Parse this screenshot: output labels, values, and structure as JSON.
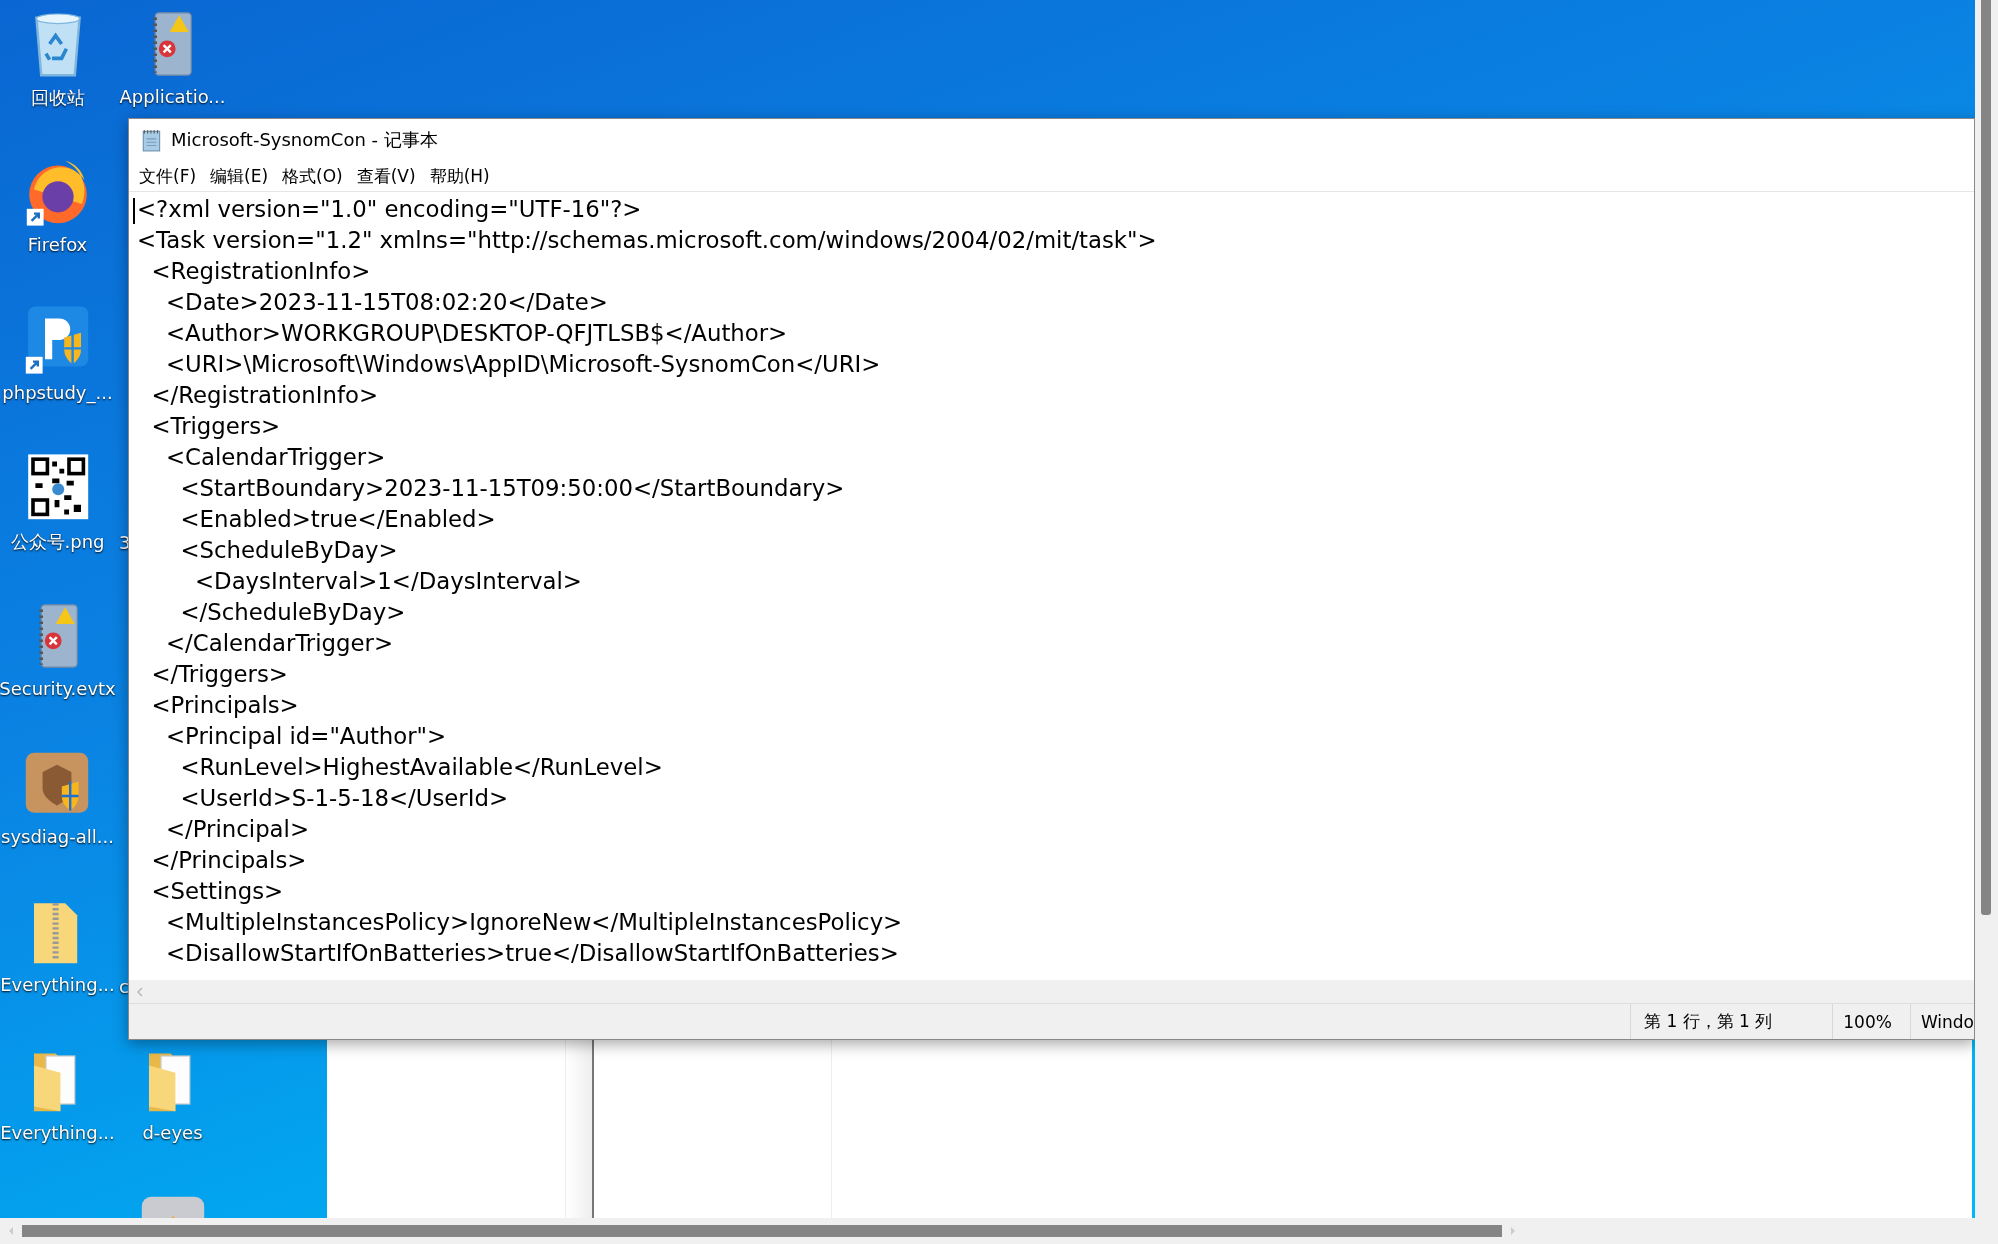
{
  "desktop": {
    "icons": [
      {
        "kind": "recycle-bin",
        "label": "回收站"
      },
      {
        "kind": "event-log",
        "label": "Applicatio..."
      },
      {
        "kind": "firefox",
        "label": "Firefox"
      },
      {
        "kind": "phpstudy",
        "label": "phpstudy_..."
      },
      {
        "kind": "qr-image",
        "label": "公众号.png"
      },
      {
        "kind": "hidden",
        "label": "3"
      },
      {
        "kind": "event-log",
        "label": "Security.evtx"
      },
      {
        "kind": "package",
        "label": "sysdiag-all..."
      },
      {
        "kind": "zip-folder",
        "label": "Everything..."
      },
      {
        "kind": "hidden",
        "label": "c"
      },
      {
        "kind": "folder",
        "label": "Everything..."
      },
      {
        "kind": "folder",
        "label": "d-eyes"
      },
      {
        "kind": "app"
      }
    ]
  },
  "notepad": {
    "title": "Microsoft-SysnomCon - 记事本",
    "menu": [
      "文件(F)",
      "编辑(E)",
      "格式(O)",
      "查看(V)",
      "帮助(H)"
    ],
    "lines": [
      "<?xml version=\"1.0\" encoding=\"UTF-16\"?>",
      "<Task version=\"1.2\" xmlns=\"http://schemas.microsoft.com/windows/2004/02/mit/task\">",
      "  <RegistrationInfo>",
      "    <Date>2023-11-15T08:02:20</Date>",
      "    <Author>WORKGROUP\\DESKTOP-QFJTLSB$</Author>",
      "    <URI>\\Microsoft\\Windows\\AppID\\Microsoft-SysnomCon</URI>",
      "  </RegistrationInfo>",
      "  <Triggers>",
      "    <CalendarTrigger>",
      "      <StartBoundary>2023-11-15T09:50:00</StartBoundary>",
      "      <Enabled>true</Enabled>",
      "      <ScheduleByDay>",
      "        <DaysInterval>1</DaysInterval>",
      "      </ScheduleByDay>",
      "    </CalendarTrigger>",
      "  </Triggers>",
      "  <Principals>",
      "    <Principal id=\"Author\">",
      "      <RunLevel>HighestAvailable</RunLevel>",
      "      <UserId>S-1-5-18</UserId>",
      "    </Principal>",
      "  </Principals>",
      "  <Settings>",
      "    <MultipleInstancesPolicy>IgnoreNew</MultipleInstancesPolicy>",
      "    <DisallowStartIfOnBatteries>true</DisallowStartIfOnBatteries>"
    ],
    "status": [
      "第 1 行，第 1 列",
      "100%",
      "Windo"
    ]
  }
}
